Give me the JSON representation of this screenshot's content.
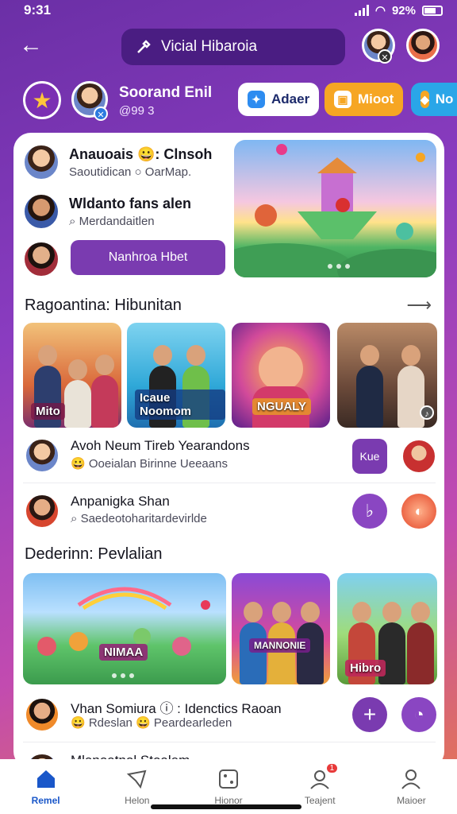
{
  "status_bar": {
    "time": "9:31",
    "battery": "92%"
  },
  "header": {
    "search_text": "Vicial Hibaroia"
  },
  "profile": {
    "name": "Soorand Enil",
    "sub": "@99 3",
    "chips": [
      {
        "label": "Adaer",
        "icon": "twitter-bird-icon",
        "bg": "#ffffff",
        "fg": "#1c2a6b"
      },
      {
        "label": "Mioot",
        "icon": "calendar-icon",
        "bg": "#f6a623",
        "fg": "#ffffff"
      },
      {
        "label": "No",
        "icon": "tag-icon",
        "bg": "#2aa6e8",
        "fg": "#ffffff"
      }
    ]
  },
  "friends": [
    {
      "title": "Anauoais 😀: Clnsoh",
      "sub": "Saoutidican ○ OarMap."
    },
    {
      "title": "Wldanto fans alen",
      "sub": "⌕ Merdandaitlen"
    }
  ],
  "friends_button": "Nanhroa Hbet",
  "section1": {
    "title": "Ragoantina: Hibunitan",
    "tiles": [
      {
        "label": "Mito"
      },
      {
        "label": "Icaue Noomom"
      },
      {
        "label": "NGUALY"
      },
      {
        "label": ""
      }
    ]
  },
  "rows1": [
    {
      "title": "Avoh Neum Tireb Yearandons",
      "sub": "😀 Ooeialan Birinne Ueeaans",
      "btn": "Kue"
    },
    {
      "title": "Anpanigka Shan",
      "sub": "⌕ Saedeotoharitardevirlde",
      "btn": "♭"
    }
  ],
  "section2": {
    "title": "Dederinn: Pevlalian",
    "tiles": [
      {
        "label": "NIMAA"
      },
      {
        "label": "MANNONIE"
      },
      {
        "label": "Hibro"
      }
    ]
  },
  "rows2": [
    {
      "title": "Vhan Somiura ⓘ : Idenctics Raoan",
      "sub": "😀 Rdeslan 😀 Peardearleden",
      "btn": "+"
    },
    {
      "title": "Mlanoatnol Stoalem",
      "sub": ""
    }
  ],
  "nav": [
    {
      "label": "Remel",
      "icon": "home-icon"
    },
    {
      "label": "Helon",
      "icon": "plane-icon"
    },
    {
      "label": "Hionor",
      "icon": "dice-icon"
    },
    {
      "label": "Teajent",
      "icon": "profile-alert-icon",
      "badge": "1"
    },
    {
      "label": "Maioer",
      "icon": "user-icon"
    }
  ],
  "colors": {
    "accent": "#7a3bb0",
    "nav_active": "#1a57c9",
    "search_bg": "#4a1d82"
  }
}
